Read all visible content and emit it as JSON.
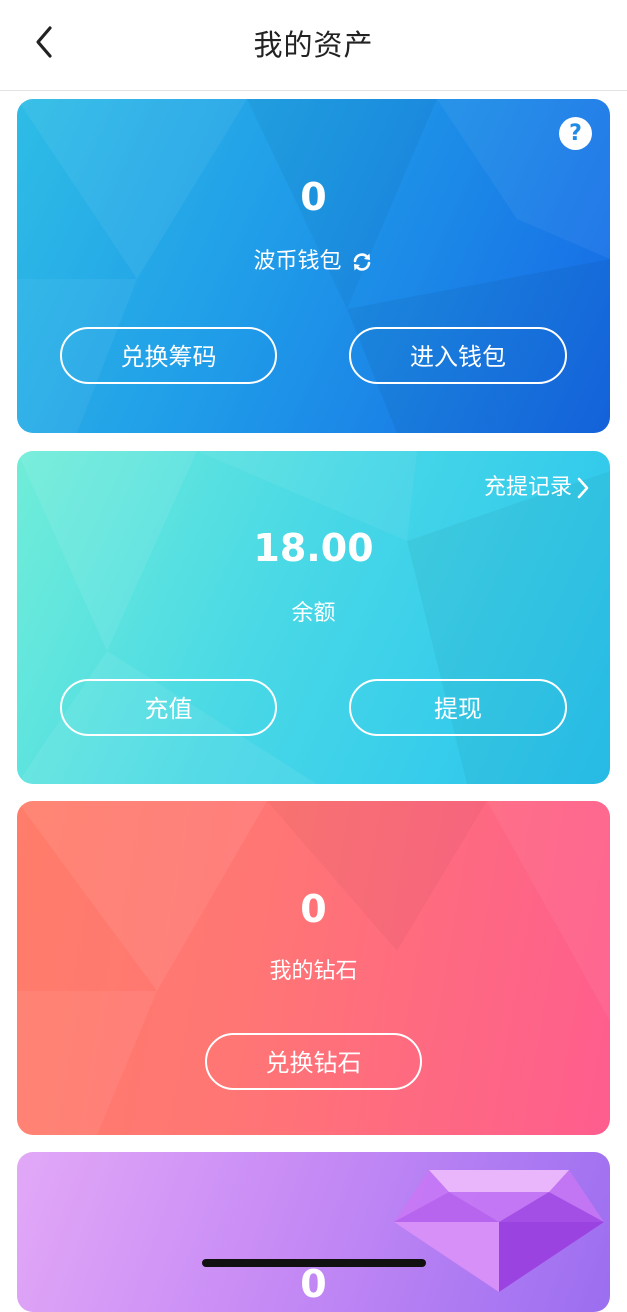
{
  "header": {
    "title": "我的资产"
  },
  "wallet_card": {
    "amount": "0",
    "label": "波币钱包",
    "exchange_button": "兑换筹码",
    "enter_button": "进入钱包"
  },
  "balance_card": {
    "record_link": "充提记录",
    "amount": "18.00",
    "label": "余额",
    "recharge_button": "充值",
    "withdraw_button": "提现"
  },
  "diamond_card": {
    "amount": "0",
    "label": "我的钻石",
    "exchange_button": "兑换钻石"
  },
  "fourth_card": {
    "amount": "0"
  }
}
